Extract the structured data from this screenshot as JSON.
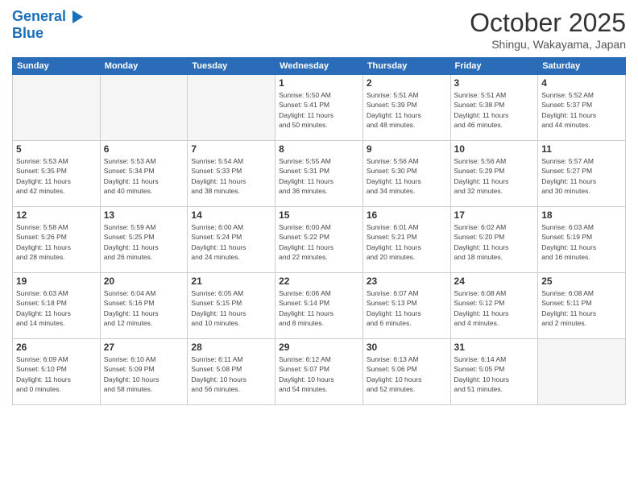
{
  "header": {
    "logo_line1": "General",
    "logo_line2": "Blue",
    "month_title": "October 2025",
    "location": "Shingu, Wakayama, Japan"
  },
  "days_of_week": [
    "Sunday",
    "Monday",
    "Tuesday",
    "Wednesday",
    "Thursday",
    "Friday",
    "Saturday"
  ],
  "weeks": [
    [
      {
        "num": "",
        "info": ""
      },
      {
        "num": "",
        "info": ""
      },
      {
        "num": "",
        "info": ""
      },
      {
        "num": "1",
        "info": "Sunrise: 5:50 AM\nSunset: 5:41 PM\nDaylight: 11 hours\nand 50 minutes."
      },
      {
        "num": "2",
        "info": "Sunrise: 5:51 AM\nSunset: 5:39 PM\nDaylight: 11 hours\nand 48 minutes."
      },
      {
        "num": "3",
        "info": "Sunrise: 5:51 AM\nSunset: 5:38 PM\nDaylight: 11 hours\nand 46 minutes."
      },
      {
        "num": "4",
        "info": "Sunrise: 5:52 AM\nSunset: 5:37 PM\nDaylight: 11 hours\nand 44 minutes."
      }
    ],
    [
      {
        "num": "5",
        "info": "Sunrise: 5:53 AM\nSunset: 5:35 PM\nDaylight: 11 hours\nand 42 minutes."
      },
      {
        "num": "6",
        "info": "Sunrise: 5:53 AM\nSunset: 5:34 PM\nDaylight: 11 hours\nand 40 minutes."
      },
      {
        "num": "7",
        "info": "Sunrise: 5:54 AM\nSunset: 5:33 PM\nDaylight: 11 hours\nand 38 minutes."
      },
      {
        "num": "8",
        "info": "Sunrise: 5:55 AM\nSunset: 5:31 PM\nDaylight: 11 hours\nand 36 minutes."
      },
      {
        "num": "9",
        "info": "Sunrise: 5:56 AM\nSunset: 5:30 PM\nDaylight: 11 hours\nand 34 minutes."
      },
      {
        "num": "10",
        "info": "Sunrise: 5:56 AM\nSunset: 5:29 PM\nDaylight: 11 hours\nand 32 minutes."
      },
      {
        "num": "11",
        "info": "Sunrise: 5:57 AM\nSunset: 5:27 PM\nDaylight: 11 hours\nand 30 minutes."
      }
    ],
    [
      {
        "num": "12",
        "info": "Sunrise: 5:58 AM\nSunset: 5:26 PM\nDaylight: 11 hours\nand 28 minutes."
      },
      {
        "num": "13",
        "info": "Sunrise: 5:59 AM\nSunset: 5:25 PM\nDaylight: 11 hours\nand 26 minutes."
      },
      {
        "num": "14",
        "info": "Sunrise: 6:00 AM\nSunset: 5:24 PM\nDaylight: 11 hours\nand 24 minutes."
      },
      {
        "num": "15",
        "info": "Sunrise: 6:00 AM\nSunset: 5:22 PM\nDaylight: 11 hours\nand 22 minutes."
      },
      {
        "num": "16",
        "info": "Sunrise: 6:01 AM\nSunset: 5:21 PM\nDaylight: 11 hours\nand 20 minutes."
      },
      {
        "num": "17",
        "info": "Sunrise: 6:02 AM\nSunset: 5:20 PM\nDaylight: 11 hours\nand 18 minutes."
      },
      {
        "num": "18",
        "info": "Sunrise: 6:03 AM\nSunset: 5:19 PM\nDaylight: 11 hours\nand 16 minutes."
      }
    ],
    [
      {
        "num": "19",
        "info": "Sunrise: 6:03 AM\nSunset: 5:18 PM\nDaylight: 11 hours\nand 14 minutes."
      },
      {
        "num": "20",
        "info": "Sunrise: 6:04 AM\nSunset: 5:16 PM\nDaylight: 11 hours\nand 12 minutes."
      },
      {
        "num": "21",
        "info": "Sunrise: 6:05 AM\nSunset: 5:15 PM\nDaylight: 11 hours\nand 10 minutes."
      },
      {
        "num": "22",
        "info": "Sunrise: 6:06 AM\nSunset: 5:14 PM\nDaylight: 11 hours\nand 8 minutes."
      },
      {
        "num": "23",
        "info": "Sunrise: 6:07 AM\nSunset: 5:13 PM\nDaylight: 11 hours\nand 6 minutes."
      },
      {
        "num": "24",
        "info": "Sunrise: 6:08 AM\nSunset: 5:12 PM\nDaylight: 11 hours\nand 4 minutes."
      },
      {
        "num": "25",
        "info": "Sunrise: 6:08 AM\nSunset: 5:11 PM\nDaylight: 11 hours\nand 2 minutes."
      }
    ],
    [
      {
        "num": "26",
        "info": "Sunrise: 6:09 AM\nSunset: 5:10 PM\nDaylight: 11 hours\nand 0 minutes."
      },
      {
        "num": "27",
        "info": "Sunrise: 6:10 AM\nSunset: 5:09 PM\nDaylight: 10 hours\nand 58 minutes."
      },
      {
        "num": "28",
        "info": "Sunrise: 6:11 AM\nSunset: 5:08 PM\nDaylight: 10 hours\nand 56 minutes."
      },
      {
        "num": "29",
        "info": "Sunrise: 6:12 AM\nSunset: 5:07 PM\nDaylight: 10 hours\nand 54 minutes."
      },
      {
        "num": "30",
        "info": "Sunrise: 6:13 AM\nSunset: 5:06 PM\nDaylight: 10 hours\nand 52 minutes."
      },
      {
        "num": "31",
        "info": "Sunrise: 6:14 AM\nSunset: 5:05 PM\nDaylight: 10 hours\nand 51 minutes."
      },
      {
        "num": "",
        "info": ""
      }
    ]
  ]
}
